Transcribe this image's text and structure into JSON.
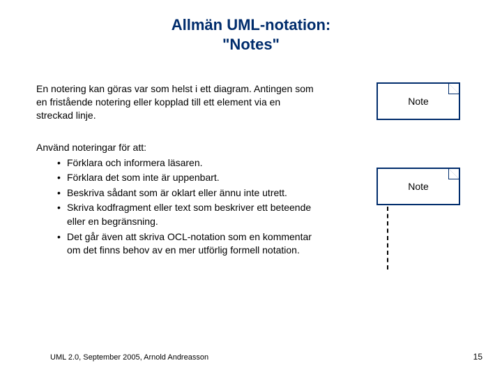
{
  "title_line1": "Allmän UML-notation:",
  "title_line2": "\"Notes\"",
  "intro": "En notering kan göras var som helst i ett diagram. Antingen som en fristående notering eller kopplad till ett element via en streckad linje.",
  "uses_heading": "Använd noteringar för att:",
  "uses": [
    "Förklara och informera läsaren.",
    "Förklara det som inte är uppenbart.",
    "Beskriva sådant som är oklart eller ännu inte utrett.",
    "Skriva kodfragment eller text som beskriver ett beteende eller en begränsning.",
    "Det går även att skriva OCL-notation som en kommentar om det finns behov av en mer utförlig formell notation."
  ],
  "note_label_1": "Note",
  "note_label_2": "Note",
  "footer_left": "UML 2.0, September 2005, Arnold Andreasson",
  "footer_right": "15"
}
